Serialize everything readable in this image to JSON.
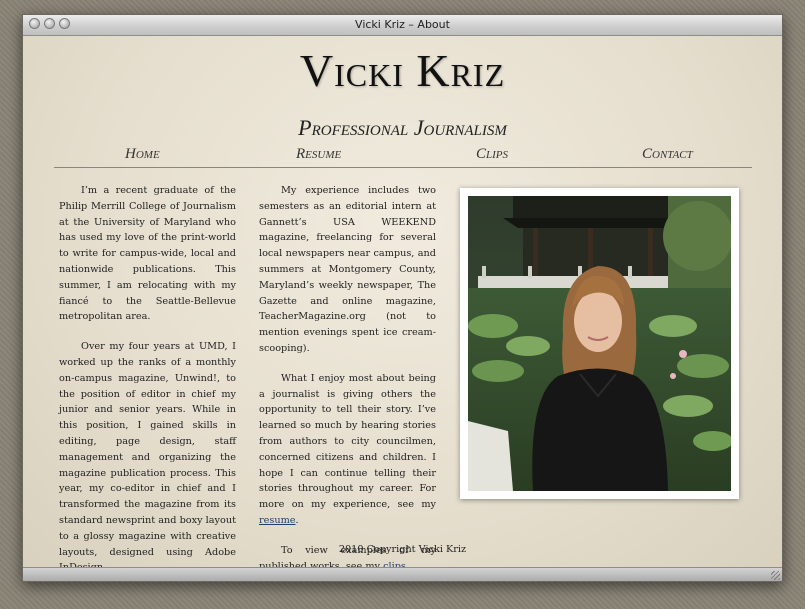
{
  "window": {
    "title": "Vicki Kriz – About"
  },
  "header": {
    "site_title": "Vicki Kriz",
    "site_subtitle": "Professional Journalism"
  },
  "nav": [
    {
      "label": "Home"
    },
    {
      "label": "Resume"
    },
    {
      "label": "Clips"
    },
    {
      "label": "Contact"
    }
  ],
  "content": {
    "col1": {
      "p1": "I’m a recent graduate of the Philip Merrill College of Journalism at the University of Maryland who has used my love of the print-world to write for campus-wide, local and nationwide publications. This summer, I am relocating with my fiancé to the Seattle-Bellevue metropolitan area.",
      "p2": "Over my four years at UMD, I worked up the ranks of a monthly on-campus magazine, Unwind!, to the position of editor in chief my junior and senior years. While in this position, I gained skills in editing, page design, staff management and organizing the magazine publication process. This year, my co-editor in chief and I transformed the magazine from its standard newsprint and boxy layout to a glossy magazine with creative layouts, designed using Adobe InDesign."
    },
    "col2": {
      "p1": "My experience includes two semesters as an editorial intern at Gannett’s USA WEEKEND magazine, freelancing for several local newspapers near campus, and summers at Montgomery County, Maryland’s weekly newspaper, The Gazette and online magazine, TeacherMagazine.org (not to mention evenings spent ice cream-scooping).",
      "p2_text": "What I enjoy most about being a journalist is giving others the opportunity to tell their story. I’ve learned so much by hearing stories from authors to city councilmen, concerned citizens and children. I hope I can continue telling their stories throughout my career. For more on my experience, see my ",
      "p2_link": "resume",
      "p2_end": ".",
      "p3_text": "To view examples of my published works, see my ",
      "p3_link": "clips",
      "p3_end": "."
    }
  },
  "footer": {
    "copyright": "2010 Copyright Vicki Kriz"
  },
  "colors": {
    "page_background": "#e9e3d4",
    "link": "#20406a",
    "text": "#222222"
  },
  "icons": [
    "close-button-icon",
    "minimize-button-icon",
    "zoom-button-icon",
    "resize-grip-icon"
  ]
}
